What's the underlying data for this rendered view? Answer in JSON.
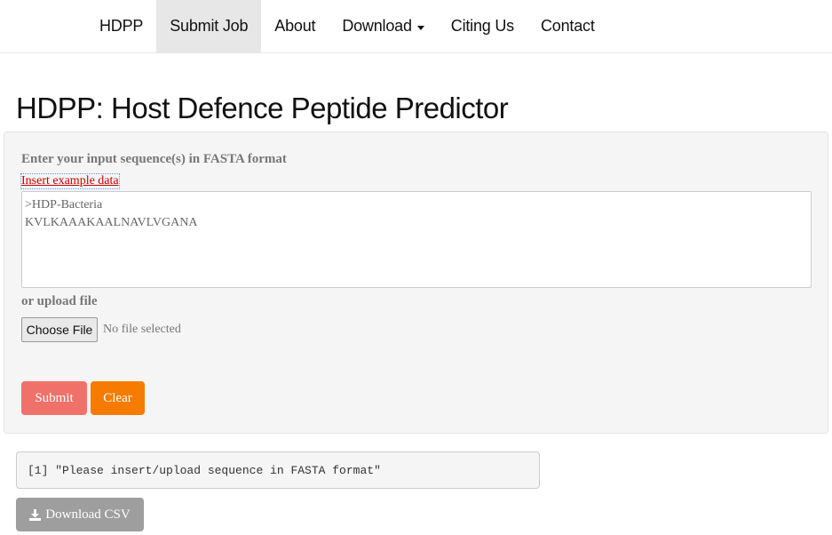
{
  "nav": {
    "items": [
      {
        "label": "HDPP",
        "active": false
      },
      {
        "label": "Submit Job",
        "active": true
      },
      {
        "label": "About",
        "active": false
      },
      {
        "label": "Download",
        "active": false,
        "dropdown": true
      },
      {
        "label": "Citing Us",
        "active": false
      },
      {
        "label": "Contact",
        "active": false
      }
    ]
  },
  "page": {
    "title": "HDPP: Host Defence Peptide Predictor"
  },
  "form": {
    "input_label": "Enter your input sequence(s) in FASTA format",
    "example_link": "Insert example data",
    "sequence_value": ">HDP-Bacteria\nKVLKAAAKAALNAVLVGANA",
    "upload_label": "or upload file",
    "file_button": "Choose File",
    "file_status": "No file selected",
    "submit_label": "Submit",
    "clear_label": "Clear"
  },
  "output": {
    "message": "[1] \"Please insert/upload sequence in FASTA format\""
  },
  "download": {
    "label": "Download CSV",
    "icon": "download-icon"
  },
  "colors": {
    "submit": "#f0706a",
    "clear": "#f57c00",
    "download": "#9e9e9e",
    "link": "#cc0000"
  }
}
